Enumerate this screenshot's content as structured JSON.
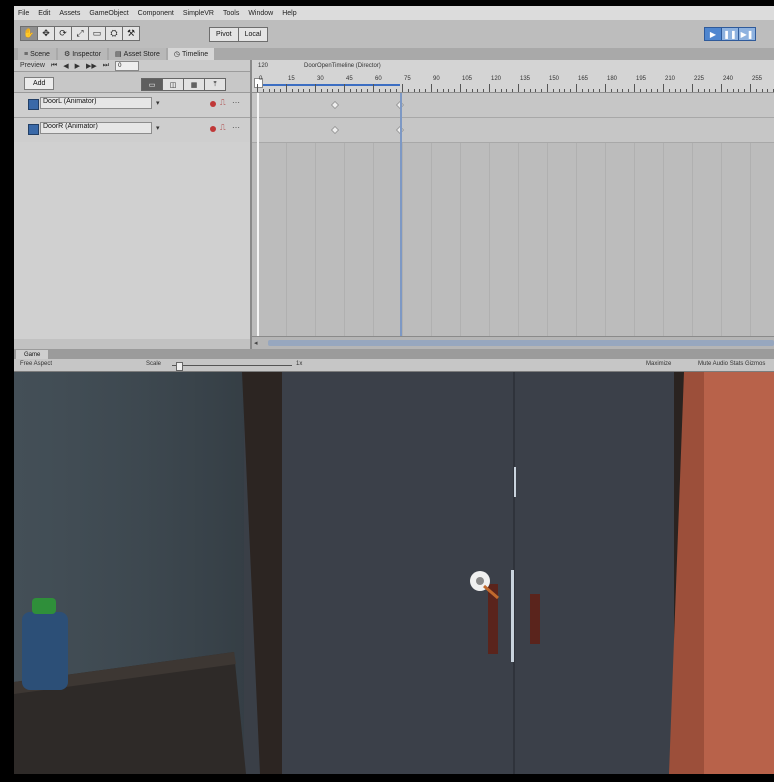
{
  "menu": [
    "File",
    "Edit",
    "Assets",
    "GameObject",
    "Component",
    "SimpleVR",
    "Tools",
    "Window",
    "Help"
  ],
  "toolbar": {
    "tools": [
      "✋",
      "✥",
      "⟳",
      "⤢",
      "▭",
      "⛭",
      "⚒"
    ],
    "pivot_label": "Pivot",
    "local_label": "Local",
    "play_buttons": [
      "▶",
      "❚❚",
      "▶❚"
    ]
  },
  "tabs": [
    {
      "icon": "≡",
      "label": "Scene"
    },
    {
      "icon": "⚙",
      "label": "Inspector"
    },
    {
      "icon": "▤",
      "label": "Asset Store"
    },
    {
      "icon": "◷",
      "label": "Timeline"
    }
  ],
  "timeline": {
    "controls": [
      "Preview",
      "⏮",
      "◀",
      "▶",
      "▶▶",
      "⏭"
    ],
    "frame_value": "0",
    "add_label": "Add",
    "mode_buttons": [
      "▭",
      "◫",
      "▦",
      "⤒"
    ],
    "clip_label": "DoorOpenTimeline (Director)",
    "current_frame_label": "120",
    "ruler_labels": [
      "0",
      "15",
      "30",
      "45",
      "60",
      "75",
      "90",
      "105",
      "120",
      "135",
      "150",
      "165",
      "180",
      "195",
      "210",
      "225",
      "240",
      "255"
    ],
    "tracks": [
      {
        "label": "DoorL (Animator)",
        "caret": "▾"
      },
      {
        "label": "DoorR (Animator)",
        "caret": "▾"
      }
    ]
  },
  "scene_view": {
    "tab_label": "Game",
    "display_dropdown": "Free Aspect",
    "scale_label": "Scale",
    "scale_value": "1x",
    "right_label_a": "Maximize",
    "right_label_b": "Mute Audio  Stats  Gizmos",
    "colors": {
      "door_dark": "#3b4049",
      "wall_left": "#444f57",
      "wall_right": "#b8624a",
      "frame_post": "#2c2522",
      "handle_red": "#5a241c",
      "bottle_cap": "#2f8f3a"
    }
  }
}
